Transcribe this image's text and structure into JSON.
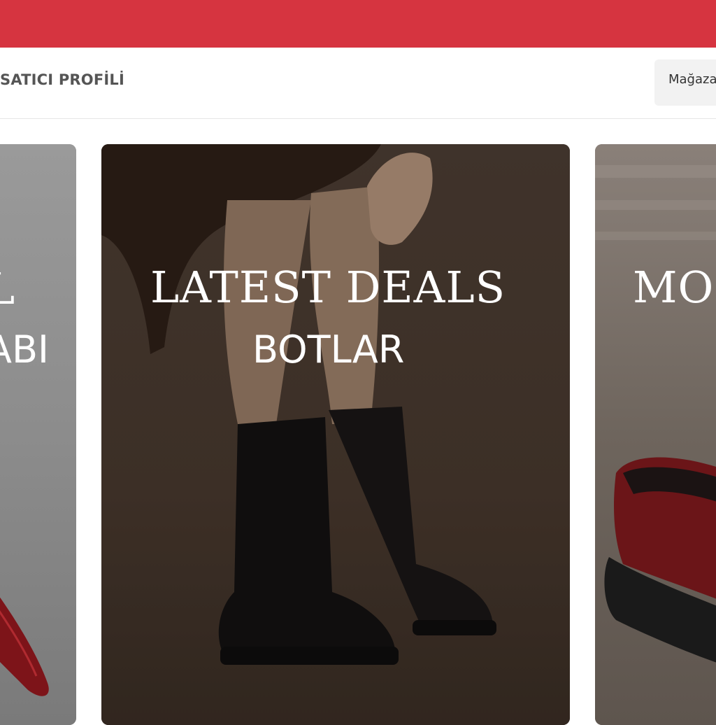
{
  "header": {
    "tab_seller_profile": "SATICI PROFİLİ",
    "store_button": "Mağaza"
  },
  "banners": [
    {
      "title": "L",
      "subtitle": "ABI"
    },
    {
      "title": "LATEST DEALS",
      "subtitle": "BOTLAR"
    },
    {
      "title": "MOS",
      "subtitle": ""
    }
  ],
  "colors": {
    "top_bar": "#d63440",
    "store_button_bg": "#f2f2f2"
  }
}
